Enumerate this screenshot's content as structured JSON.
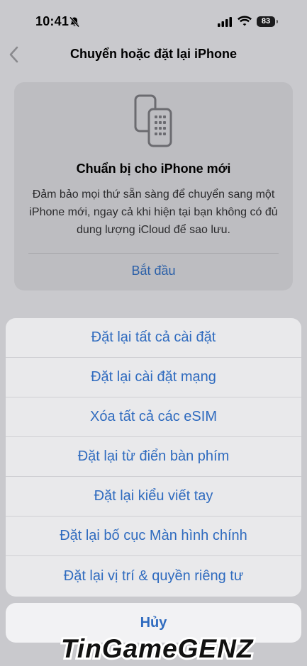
{
  "status_bar": {
    "time": "10:41",
    "battery": "83"
  },
  "nav": {
    "title": "Chuyển hoặc đặt lại iPhone"
  },
  "card": {
    "title": "Chuẩn bị cho iPhone mới",
    "description": "Đảm bảo mọi thứ sẵn sàng để chuyển sang một iPhone mới, ngay cả khi hiện tại bạn không có đủ dung lượng iCloud để sao lưu.",
    "action": "Bắt đầu"
  },
  "action_sheet": {
    "items": [
      "Đặt lại tất cả cài đặt",
      "Đặt lại cài đặt mạng",
      "Xóa tất cả các eSIM",
      "Đặt lại từ điển bàn phím",
      "Đặt lại kiểu viết tay",
      "Đặt lại bố cục Màn hình chính",
      "Đặt lại vị trí & quyền riêng tư"
    ],
    "cancel": "Hủy"
  },
  "watermark": {
    "text": "TinGameGENZ"
  },
  "colors": {
    "accent": "#2f6bbf",
    "background": "#c9c9cd"
  },
  "icons": {
    "back": "chevron-left-icon",
    "phones": "transfer-phones-icon",
    "bell": "bell-slash-icon",
    "signal": "cellular-signal-icon",
    "wifi": "wifi-icon"
  }
}
